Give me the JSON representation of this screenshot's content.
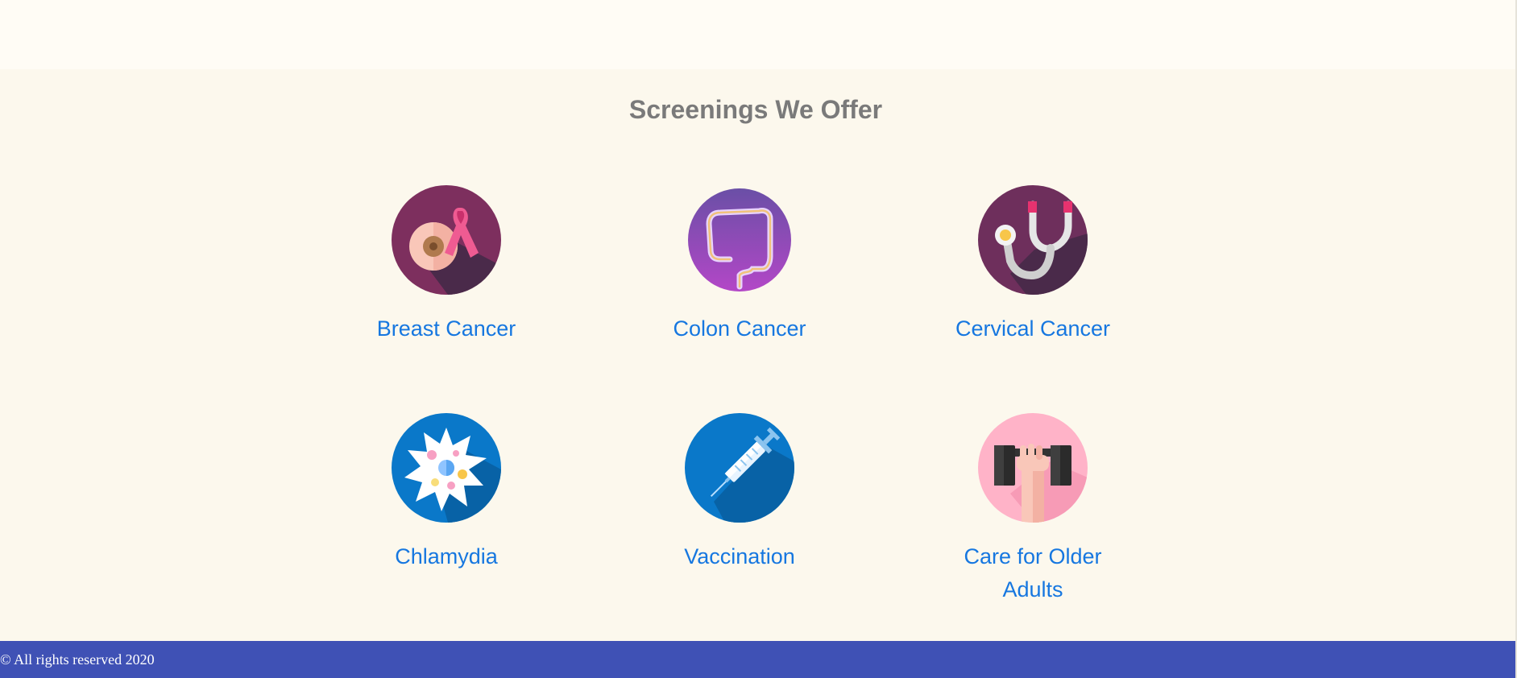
{
  "section": {
    "title": "Screenings We Offer"
  },
  "cards": [
    {
      "label": "Breast Cancer",
      "icon": "breast-cancer-ribbon-icon"
    },
    {
      "label": "Colon Cancer",
      "icon": "colon-icon"
    },
    {
      "label": "Cervical Cancer",
      "icon": "stethoscope-icon"
    },
    {
      "label": "Chlamydia",
      "icon": "bacteria-cell-icon"
    },
    {
      "label": "Vaccination",
      "icon": "syringe-icon"
    },
    {
      "label": "Care for Older Adults",
      "icon": "dumbbell-hand-icon"
    }
  ],
  "footer": {
    "text": "© All rights reserved 2020"
  },
  "colors": {
    "page_bg": "#fcf8ed",
    "title": "#7a7a7a",
    "link": "#1677e0",
    "footer_bg": "#3f51b5"
  }
}
